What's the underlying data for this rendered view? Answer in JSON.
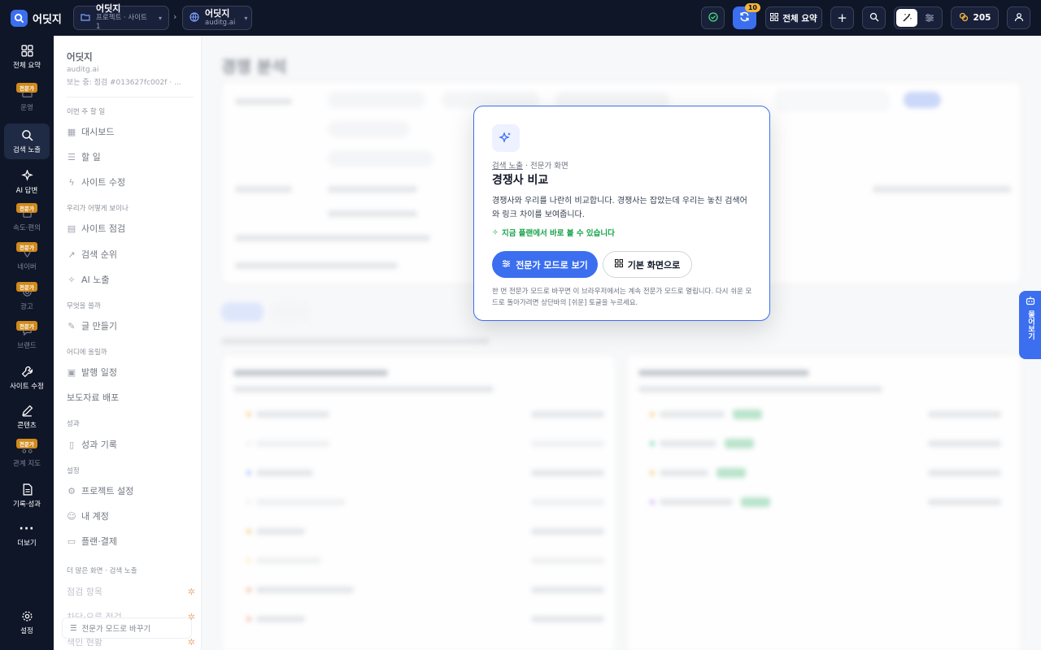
{
  "app": {
    "name": "어딧지"
  },
  "breadcrumb": [
    {
      "title": "어딧지",
      "sub": "프로젝트 · 사이트 1"
    },
    {
      "title": "어딧지",
      "sub": "auditg.ai"
    }
  ],
  "topbar": {
    "refresh_badge": "10",
    "overview_label": "전체 요약",
    "credits": "205"
  },
  "sidebar": {
    "badge": "전문가",
    "items": [
      {
        "label": "전체 요약",
        "icon": "grid-icon"
      },
      {
        "label": "운영",
        "icon": "briefcase-icon"
      },
      {
        "label": "검색 노출",
        "icon": "search-icon"
      },
      {
        "label": "AI 답변",
        "icon": "sparkle-icon"
      },
      {
        "label": "속도·편의",
        "icon": "speed-icon"
      },
      {
        "label": "네이버",
        "icon": "map-pin-icon"
      },
      {
        "label": "광고",
        "icon": "target-icon"
      },
      {
        "label": "브랜드",
        "icon": "chat-icon"
      },
      {
        "label": "사이트 수정",
        "icon": "wrench-icon"
      },
      {
        "label": "콘텐츠",
        "icon": "pen-icon"
      },
      {
        "label": "관계 지도",
        "icon": "network-icon"
      },
      {
        "label": "기록·성과",
        "icon": "doc-icon"
      },
      {
        "label": "더보기",
        "icon": "more-icon"
      },
      {
        "label": "설정",
        "icon": "gear-icon"
      }
    ]
  },
  "panel": {
    "title": "어딧지",
    "domain": "auditg.ai",
    "viewing": "보는 중: 점검 #013627fc002f · ...",
    "sections": [
      {
        "label": "이번 주 할 일",
        "items": [
          "대시보드",
          "할 일",
          "사이트 수정"
        ]
      },
      {
        "label": "우리가 어떻게 보이나",
        "items": [
          "사이트 점검",
          "검색 순위",
          "AI 노출"
        ]
      },
      {
        "label": "무엇을 쓸까",
        "items": [
          "글 만들기"
        ]
      },
      {
        "label": "어디에 올릴까",
        "items": [
          "발행 일정",
          "보도자료 배포"
        ]
      },
      {
        "label": "성과",
        "items": [
          "성과 기록"
        ]
      },
      {
        "label": "설정",
        "items": [
          "프로젝트 설정",
          "내 계정",
          "플랜·결제"
        ]
      }
    ],
    "more_section": "더 많은 화면 · 검색 노출",
    "more_items": [
      "점검 항목",
      "차단·오류 점검",
      "색인 현황"
    ],
    "expert_toggle": "전문가 모드로 바꾸기"
  },
  "modal": {
    "crumb_a": "검색 노출",
    "crumb_b": "· 전문가 화면",
    "title": "경쟁사 비교",
    "description": "경쟁사와 우리를 나란히 비교합니다. 경쟁사는 잡았는데 우리는 놓친 검색어와 링크 차이를 보여줍니다.",
    "plan_note": "지금 플랜에서 바로 볼 수 있습니다",
    "primary_button": "전문가 모드로 보기",
    "secondary_button": "기본 화면으로",
    "footnote": "한 번 전문가 모드로 바꾸면 이 브라우저에서는 계속 전문가 모드로 열립니다. 다시 쉬운 모드로 돌아가려면 상단바의 [쉬운] 토글을 누르세요."
  },
  "side_tab": {
    "label": "물어보기"
  },
  "background": {
    "page_title": "경쟁 분석"
  }
}
